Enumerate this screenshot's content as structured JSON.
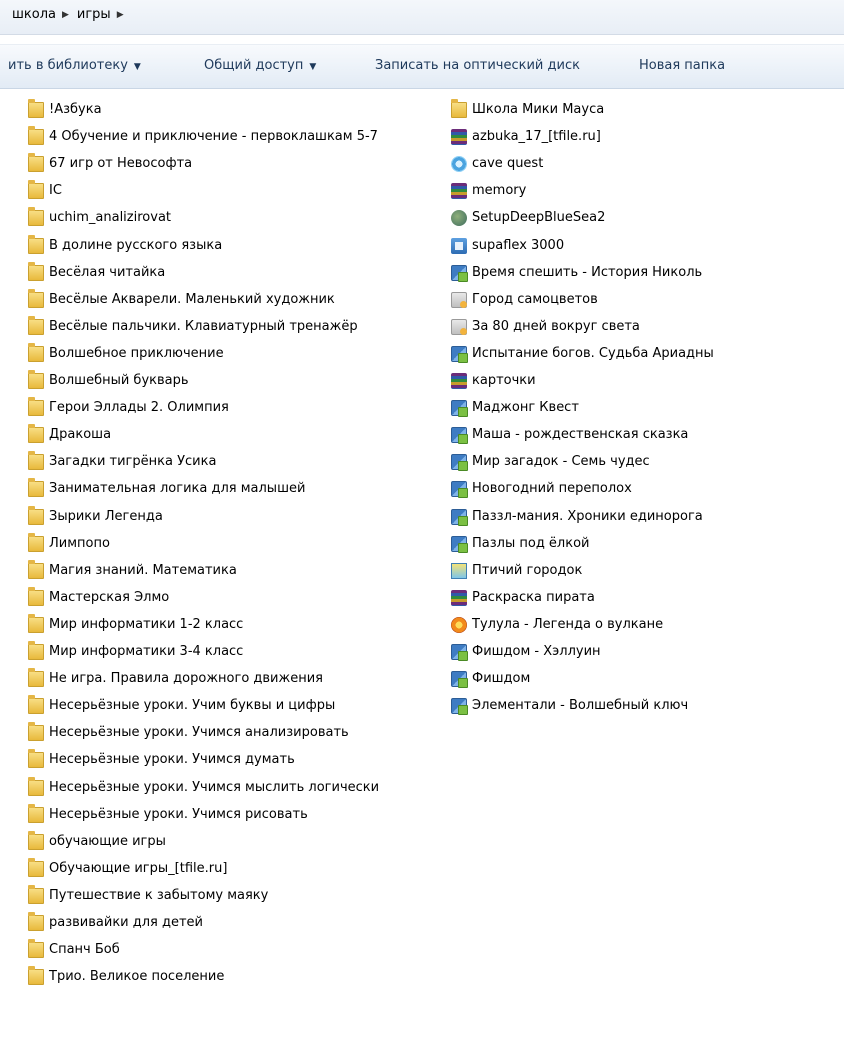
{
  "breadcrumb": [
    "школа",
    "игры"
  ],
  "toolbar": {
    "library": "ить в библиотеку",
    "share": "Общий доступ",
    "burn": "Записать на оптический диск",
    "new_folder": "Новая папка"
  },
  "files": {
    "left": [
      {
        "name": "!Азбука",
        "icon": "folder-icon"
      },
      {
        "name": "4 Обучение и приключение - первоклашкам 5-7",
        "icon": "folder-icon"
      },
      {
        "name": "67 игр от Невософта",
        "icon": "folder-icon"
      },
      {
        "name": "IC",
        "icon": "folder-icon"
      },
      {
        "name": "uchim_analizirovat",
        "icon": "folder-icon"
      },
      {
        "name": "В долине русского языка",
        "icon": "folder-icon"
      },
      {
        "name": "Весёлая читайка",
        "icon": "folder-icon"
      },
      {
        "name": "Весёлые Акварели. Маленький художник",
        "icon": "folder-icon"
      },
      {
        "name": "Весёлые пальчики. Клавиатурный тренажёр",
        "icon": "folder-icon"
      },
      {
        "name": "Волшебное приключение",
        "icon": "folder-icon"
      },
      {
        "name": "Волшебный букварь",
        "icon": "folder-icon"
      },
      {
        "name": "Герои Эллады 2. Олимпия",
        "icon": "folder-icon"
      },
      {
        "name": "Дракоша",
        "icon": "folder-icon"
      },
      {
        "name": "Загадки тигрёнка Усика",
        "icon": "folder-icon"
      },
      {
        "name": "Занимательная логика для малышей",
        "icon": "folder-icon"
      },
      {
        "name": "Зырики Легенда",
        "icon": "folder-icon"
      },
      {
        "name": "Лимпопо",
        "icon": "folder-icon"
      },
      {
        "name": "Магия знаний. Математика",
        "icon": "folder-icon"
      },
      {
        "name": "Мастерская Элмо",
        "icon": "folder-icon"
      },
      {
        "name": "Мир информатики 1-2 класс",
        "icon": "folder-icon"
      },
      {
        "name": "Мир информатики 3-4 класс",
        "icon": "folder-icon"
      },
      {
        "name": "Не игра. Правила дорожного движения",
        "icon": "folder-icon"
      },
      {
        "name": "Несерьёзные уроки. Учим буквы и цифры",
        "icon": "folder-icon"
      },
      {
        "name": "Несерьёзные уроки. Учимся анализировать",
        "icon": "folder-icon"
      },
      {
        "name": "Несерьёзные уроки. Учимся думать",
        "icon": "folder-icon"
      },
      {
        "name": "Несерьёзные уроки. Учимся мыслить логически",
        "icon": "folder-icon"
      },
      {
        "name": "Несерьёзные уроки. Учимся рисовать",
        "icon": "folder-icon"
      },
      {
        "name": "обучающие игры",
        "icon": "folder-icon"
      },
      {
        "name": "Обучающие игры_[tfile.ru]",
        "icon": "folder-icon"
      },
      {
        "name": "Путешествие к забытому маяку",
        "icon": "folder-icon"
      },
      {
        "name": "развивайки для детей",
        "icon": "folder-icon"
      },
      {
        "name": "Спанч Боб",
        "icon": "folder-icon"
      },
      {
        "name": "Трио. Великое поселение",
        "icon": "folder-icon"
      }
    ],
    "right": [
      {
        "name": "Школа Мики Мауса",
        "icon": "folder-icon"
      },
      {
        "name": "azbuka_17_[tfile.ru]",
        "icon": "winrar-archive-icon"
      },
      {
        "name": "cave quest",
        "icon": "cd-image-icon"
      },
      {
        "name": "memory",
        "icon": "winrar-archive-icon"
      },
      {
        "name": "SetupDeepBlueSea2",
        "icon": "shell-app-icon"
      },
      {
        "name": "supaflex 3000",
        "icon": "installer-icon"
      },
      {
        "name": "Время спешить - История Николь",
        "icon": "setup-icon"
      },
      {
        "name": "Город самоцветов",
        "icon": "msi-package-icon"
      },
      {
        "name": "За 80 дней вокруг света",
        "icon": "msi-package-icon"
      },
      {
        "name": "Испытание богов. Судьба Ариадны",
        "icon": "setup-icon"
      },
      {
        "name": "карточки",
        "icon": "winrar-archive-icon"
      },
      {
        "name": "Маджонг Квест",
        "icon": "setup-icon"
      },
      {
        "name": "Маша - рождественская сказка",
        "icon": "setup-icon"
      },
      {
        "name": "Мир загадок - Семь чудес",
        "icon": "setup-icon"
      },
      {
        "name": "Новогодний переполох",
        "icon": "setup-icon"
      },
      {
        "name": "Паззл-мания. Хроники единорога",
        "icon": "setup-icon"
      },
      {
        "name": "Пазлы под ёлкой",
        "icon": "setup-icon"
      },
      {
        "name": "Птичий городок",
        "icon": "bird-app-icon"
      },
      {
        "name": "Раскраска пирата",
        "icon": "winrar-archive-icon"
      },
      {
        "name": "Тулула - Легенда о вулкане",
        "icon": "volcano-app-icon"
      },
      {
        "name": "Фишдом - Хэллуин",
        "icon": "setup-icon"
      },
      {
        "name": "Фишдом",
        "icon": "setup-icon"
      },
      {
        "name": "Элементали - Волшебный ключ",
        "icon": "setup-icon"
      }
    ]
  }
}
